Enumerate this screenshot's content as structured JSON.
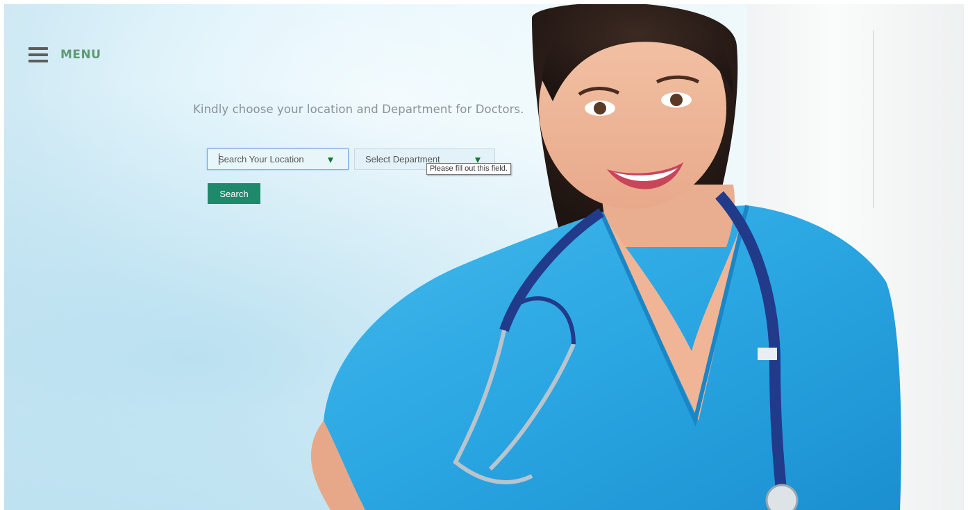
{
  "header": {
    "menu_label": "MENU"
  },
  "main": {
    "headline": "Kindly choose your location and Department for Doctors.",
    "location_select": {
      "placeholder": "Search Your Location"
    },
    "department_select": {
      "placeholder": "Select Department"
    },
    "validation_tooltip": "Please fill out this field.",
    "search_button_label": "Search"
  },
  "colors": {
    "accent_green": "#1e8a6b",
    "menu_text": "#5e9a73",
    "caret_green": "#0f7a2c"
  },
  "icons": {
    "menu": "hamburger-icon",
    "dropdown": "triangle-down-icon"
  }
}
